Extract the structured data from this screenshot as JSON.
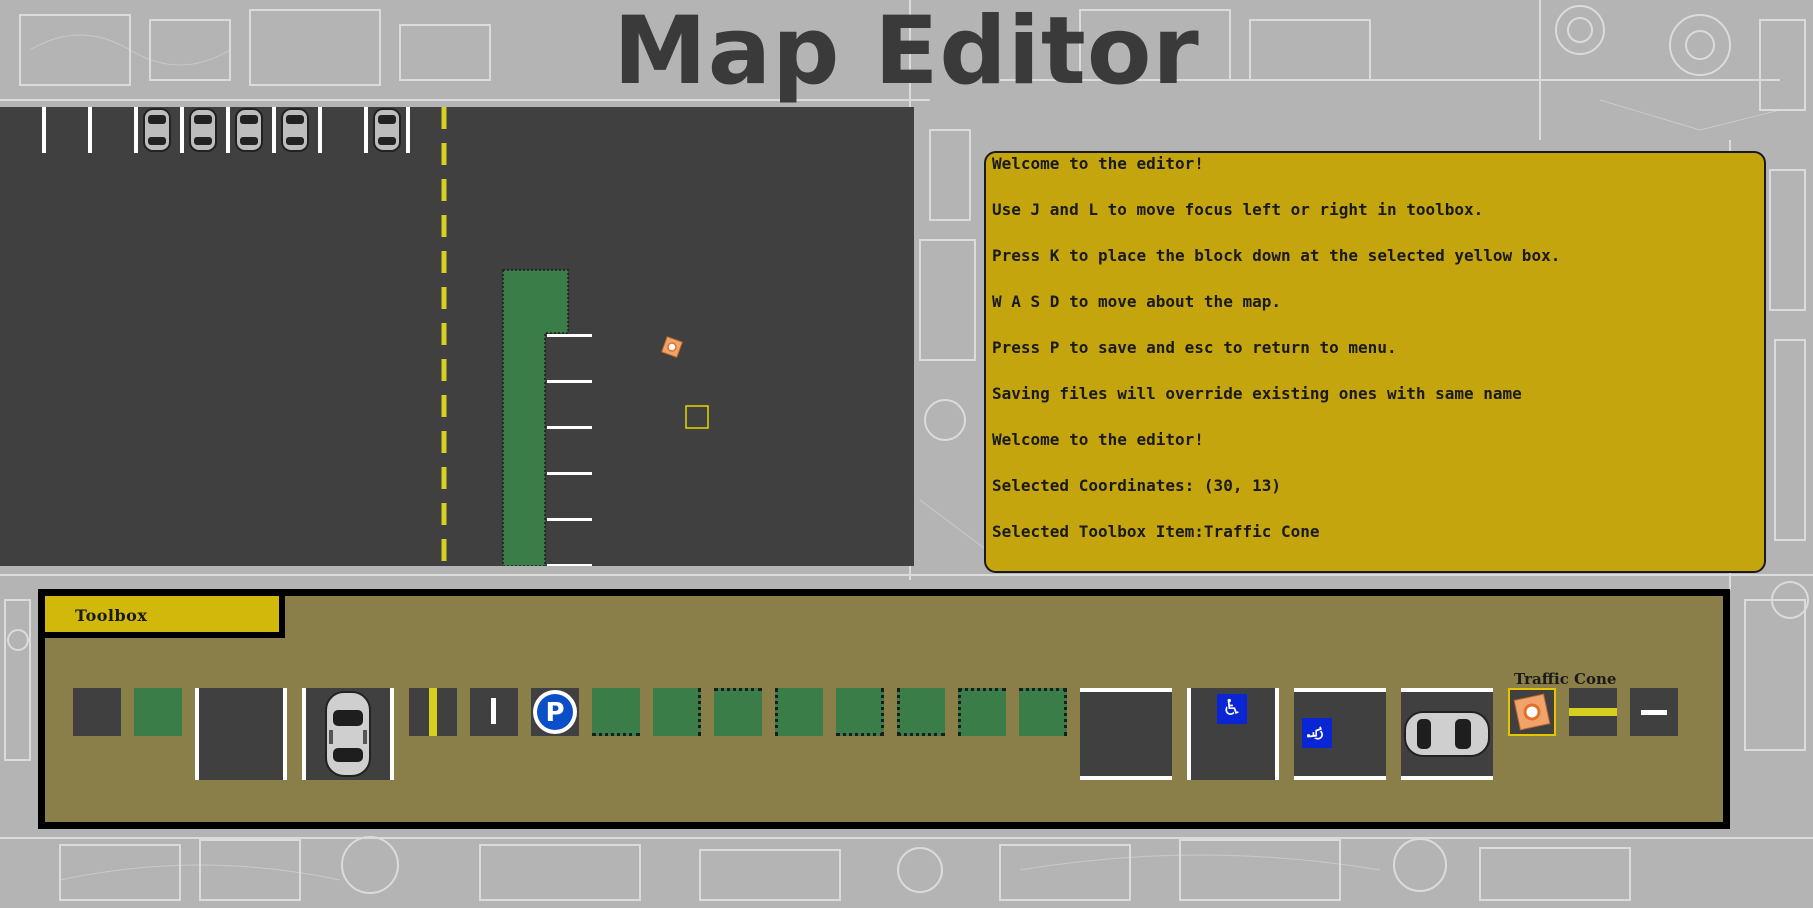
{
  "title": "Map Editor",
  "colors": {
    "asphalt": "#404040",
    "grass": "#3b7d48",
    "info_panel": "#c4a50e",
    "toolbox_bg": "#8a7f48",
    "toolbox_tab": "#d1b80a",
    "center_line": "#d8d020",
    "selection": "#e6d400",
    "handicap_blue": "#0a25d4"
  },
  "info": {
    "lines": [
      "Welcome to the editor!",
      "Use J and L to move focus left or right in toolbox.",
      "Press K to place the block down at the selected yellow box.",
      "W A S D to move about the map.",
      "Press P to save and esc to return to menu.",
      "Saving files will override existing ones with same name",
      "Welcome to the editor!",
      "Selected Coordinates: (30, 13)",
      "Selected Toolbox Item:Traffic Cone"
    ]
  },
  "toolbox": {
    "tab_label": "Toolbox",
    "selected_item_label": "Traffic Cone",
    "items": [
      {
        "name": "asphalt-tile",
        "icon": "asphalt"
      },
      {
        "name": "grass-tile",
        "icon": "grass"
      },
      {
        "name": "parking-space-empty",
        "icon": "parking-space"
      },
      {
        "name": "parking-space-car",
        "icon": "parking-space-car"
      },
      {
        "name": "center-line-vertical",
        "icon": "yellow-line"
      },
      {
        "name": "white-line-short",
        "icon": "white-line"
      },
      {
        "name": "parking-sign",
        "icon": "P",
        "label": "P"
      },
      {
        "name": "curb-bottom",
        "icon": "grass-curb"
      },
      {
        "name": "curb-right",
        "icon": "grass-curb"
      },
      {
        "name": "curb-top",
        "icon": "grass-curb"
      },
      {
        "name": "curb-left",
        "icon": "grass-curb"
      },
      {
        "name": "curb-corner-1",
        "icon": "grass-curb"
      },
      {
        "name": "curb-corner-2",
        "icon": "grass-curb"
      },
      {
        "name": "curb-corner-3",
        "icon": "grass-curb"
      },
      {
        "name": "curb-corner-4",
        "icon": "grass-curb"
      },
      {
        "name": "parking-space-wide",
        "icon": "parking-space"
      },
      {
        "name": "handicap-space",
        "icon": "handicap"
      },
      {
        "name": "handicap-space-rotated",
        "icon": "handicap"
      },
      {
        "name": "parking-space-car-rotated",
        "icon": "parking-space-car"
      },
      {
        "name": "traffic-cone",
        "icon": "cone",
        "selected": true
      },
      {
        "name": "center-line-horizontal",
        "icon": "yellow-line"
      },
      {
        "name": "white-line-horizontal",
        "icon": "white-line"
      }
    ]
  },
  "map": {
    "selected_coordinates": [
      30,
      13
    ]
  }
}
